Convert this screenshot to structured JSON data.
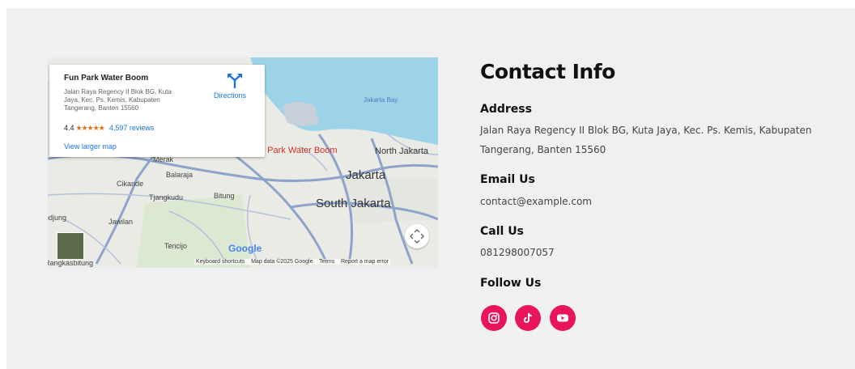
{
  "map": {
    "place_name": "Fun Park Water Boom",
    "address_lines": [
      "Jalan Raya Regency II Blok BG, Kuta",
      "Jaya, Kec. Ps. Kemis, Kabupaten",
      "Tangerang, Banten 15560"
    ],
    "rating": "4.4",
    "stars": "★★★★★",
    "reviews": "4,597 reviews",
    "directions_label": "Directions",
    "view_larger": "View larger map",
    "labels": {
      "jakarta_bay": "Jakarta Bay",
      "merak": "Merak",
      "balaraja": "Balaraja",
      "cikande": "Cikande",
      "tjangkudu": "Tjangkudu",
      "bitung": "Bitung",
      "ndjung": "ndjung",
      "jawilan": "Jawilan",
      "tencijo": "Tencijo",
      "rangkasbitung": "Rangkasbitung",
      "fun_park": "n Park Water Boom",
      "north_jakarta": "North Jakarta",
      "jakarta": "Jakarta",
      "south_jakarta": "South Jakarta",
      "google": "Google"
    },
    "footer": {
      "shortcuts": "Keyboard shortcuts",
      "map_data": "Map data ©2025 Google",
      "terms": "Terms",
      "report": "Report a map error"
    }
  },
  "contact": {
    "title": "Contact Info",
    "address_heading": "Address",
    "address_line1": "Jalan Raya Regency II Blok BG, Kuta Jaya, Kec. Ps. Kemis, Kabupaten",
    "address_line2": "Tangerang, Banten 15560",
    "email_heading": "Email Us",
    "email": "contact@example.com",
    "call_heading": "Call Us",
    "phone": "081298007057",
    "follow_heading": "Follow Us"
  },
  "social": [
    "instagram-icon",
    "tiktok-icon",
    "youtube-icon"
  ],
  "colors": {
    "social_bg": "#e8155a",
    "map_link": "#1a73e8"
  }
}
